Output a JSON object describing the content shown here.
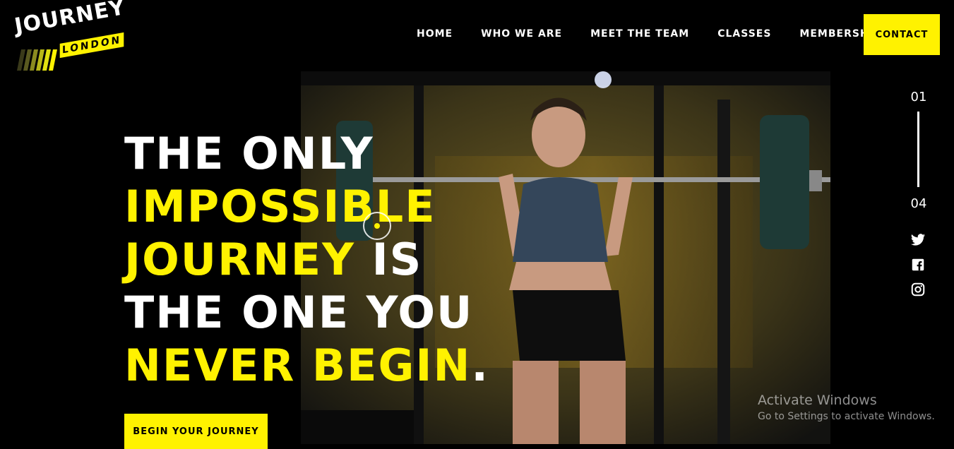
{
  "brand": {
    "name": "JOURNEY",
    "sub": "LONDON"
  },
  "colors": {
    "accent": "#fff200",
    "background": "#000000",
    "text": "#ffffff"
  },
  "nav": {
    "items": [
      {
        "label": "HOME"
      },
      {
        "label": "WHO WE ARE"
      },
      {
        "label": "MEET THE TEAM"
      },
      {
        "label": "CLASSES"
      },
      {
        "label": "MEMBERSHIPS"
      }
    ],
    "contact_label": "CONTACT"
  },
  "hero": {
    "line1": "THE ONLY",
    "line2": "IMPOSSIBLE",
    "line3_highlight": "JOURNEY",
    "line3_rest": " IS",
    "line4": "THE ONE YOU",
    "line5": "NEVER BEGIN",
    "line5_period": ".",
    "cta_label": "BEGIN YOUR JOURNEY",
    "image": "woman-barbell-squat-gym-photo"
  },
  "slider": {
    "current": "01",
    "total": "04"
  },
  "social": [
    {
      "icon": "twitter-icon"
    },
    {
      "icon": "facebook-icon"
    },
    {
      "icon": "instagram-icon"
    }
  ],
  "watermark": {
    "title": "Activate Windows",
    "subtitle": "Go to Settings to activate Windows."
  }
}
